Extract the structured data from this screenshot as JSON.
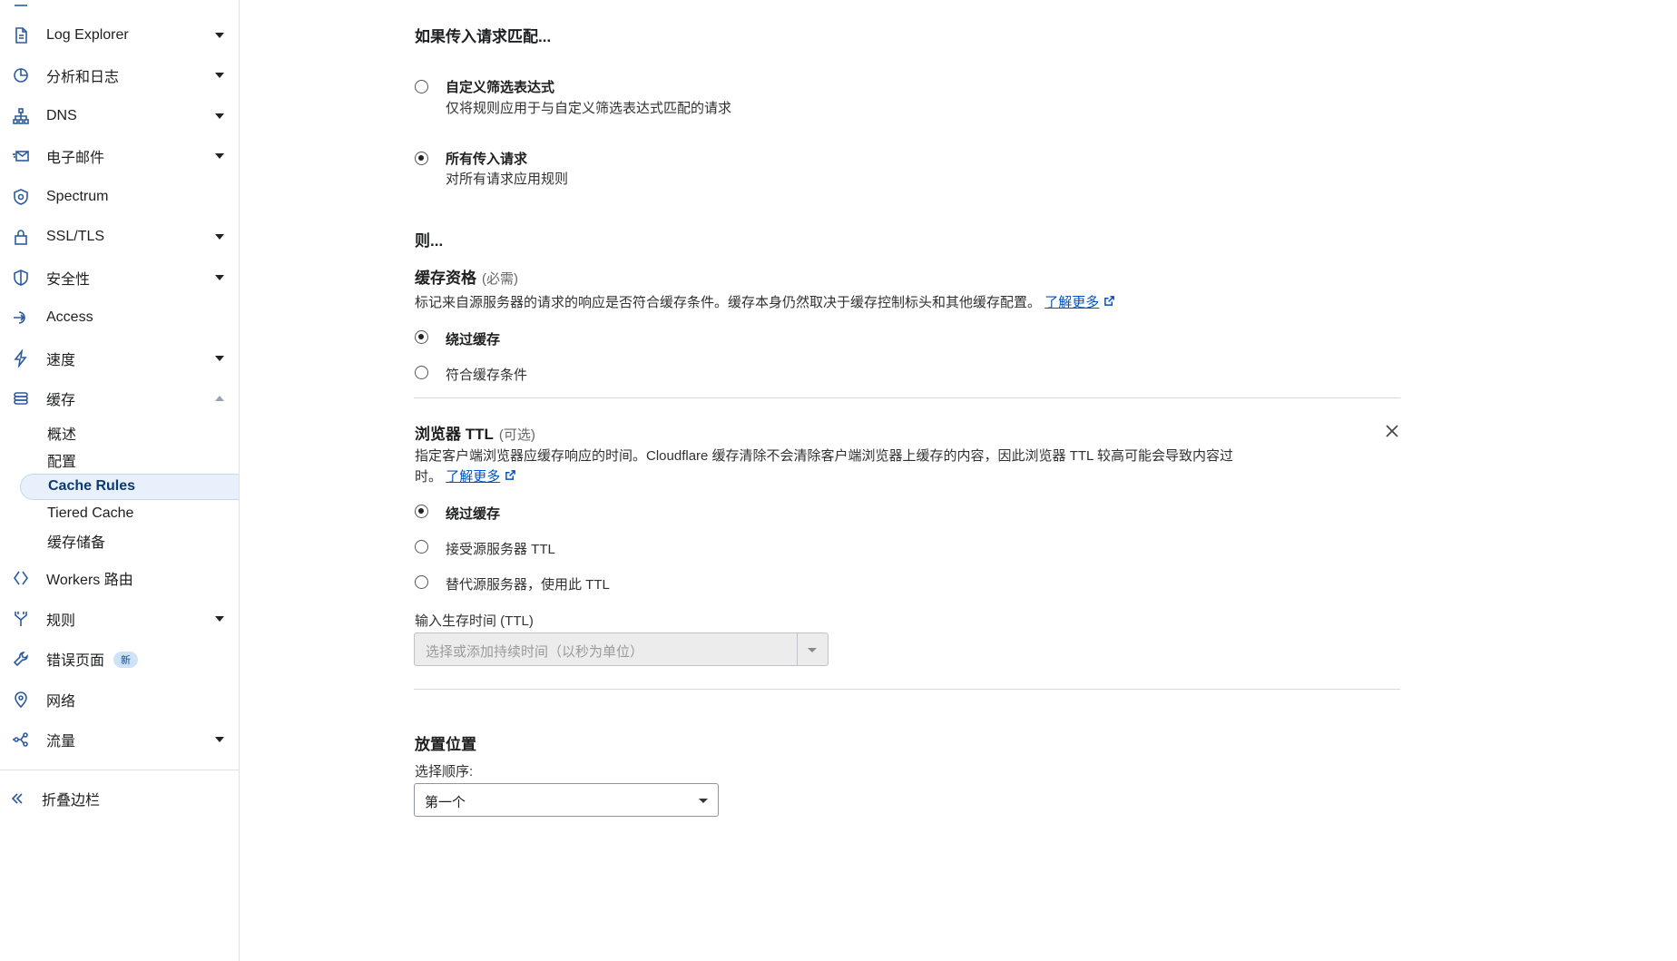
{
  "sidebar": {
    "top_partial": {
      "label": "",
      "badge": ""
    },
    "items": [
      {
        "label": "Log Explorer",
        "icon": "log-explorer-icon",
        "caret": true
      },
      {
        "label": "分析和日志",
        "icon": "analytics-icon",
        "caret": true
      },
      {
        "label": "DNS",
        "icon": "dns-network-icon",
        "caret": true
      },
      {
        "label": "电子邮件",
        "icon": "email-icon",
        "caret": true
      },
      {
        "label": "Spectrum",
        "icon": "spectrum-shield-icon",
        "caret": false
      },
      {
        "label": "SSL/TLS",
        "icon": "lock-icon",
        "caret": true
      },
      {
        "label": "安全性",
        "icon": "shield-icon",
        "caret": true
      },
      {
        "label": "Access",
        "icon": "access-arrow-icon",
        "caret": false
      },
      {
        "label": "速度",
        "icon": "lightning-icon",
        "caret": true
      },
      {
        "label": "缓存",
        "icon": "cache-stack-icon",
        "caret": "up"
      }
    ],
    "cache_subitems": [
      "概述",
      "配置",
      "Cache Rules",
      "Tiered Cache",
      "缓存储备"
    ],
    "items_after": [
      {
        "label": "Workers 路由",
        "icon": "workers-icon",
        "caret": false
      },
      {
        "label": "规则",
        "icon": "rules-fork-icon",
        "caret": true
      },
      {
        "label": "错误页面",
        "icon": "wrench-icon",
        "caret": false,
        "badge": "新"
      },
      {
        "label": "网络",
        "icon": "location-pin-icon",
        "caret": false
      },
      {
        "label": "流量",
        "icon": "traffic-icon",
        "caret": true
      }
    ],
    "collapse_label": "折叠边栏"
  },
  "main": {
    "match_heading": "如果传入请求匹配...",
    "match_options": [
      {
        "title": "自定义筛选表达式",
        "desc": "仅将规则应用于与自定义筛选表达式匹配的请求",
        "checked": false
      },
      {
        "title": "所有传入请求",
        "desc": "对所有请求应用规则",
        "checked": true
      }
    ],
    "then_heading": "则...",
    "eligibility": {
      "title": "缓存资格",
      "qualifier": "(必需)",
      "desc": "标记来自源服务器的请求的响应是否符合缓存条件。缓存本身仍然取决于缓存控制标头和其他缓存配置。",
      "learn_more": "了解更多",
      "options": [
        {
          "label": "绕过缓存",
          "checked": true
        },
        {
          "label": "符合缓存条件",
          "checked": false
        }
      ]
    },
    "browser_ttl": {
      "title": "浏览器 TTL",
      "qualifier": "(可选)",
      "desc_line1": "指定客户端浏览器应缓存响应的时间。Cloudflare 缓存清除不会清除客户端浏览器上缓存的内容，因此浏览器 TTL 较高可能会导致内容过",
      "desc_line2": "时。",
      "learn_more": "了解更多",
      "options": [
        {
          "label": "绕过缓存",
          "checked": true
        },
        {
          "label": "接受源服务器 TTL",
          "checked": false
        },
        {
          "label": "替代源服务器，使用此 TTL",
          "checked": false
        }
      ],
      "ttl_label": "输入生存时间 (TTL)",
      "ttl_placeholder": "选择或添加持续时间（以秒为单位）"
    },
    "placement": {
      "title": "放置位置",
      "order_label": "选择顺序:",
      "order_value": "第一个"
    }
  }
}
